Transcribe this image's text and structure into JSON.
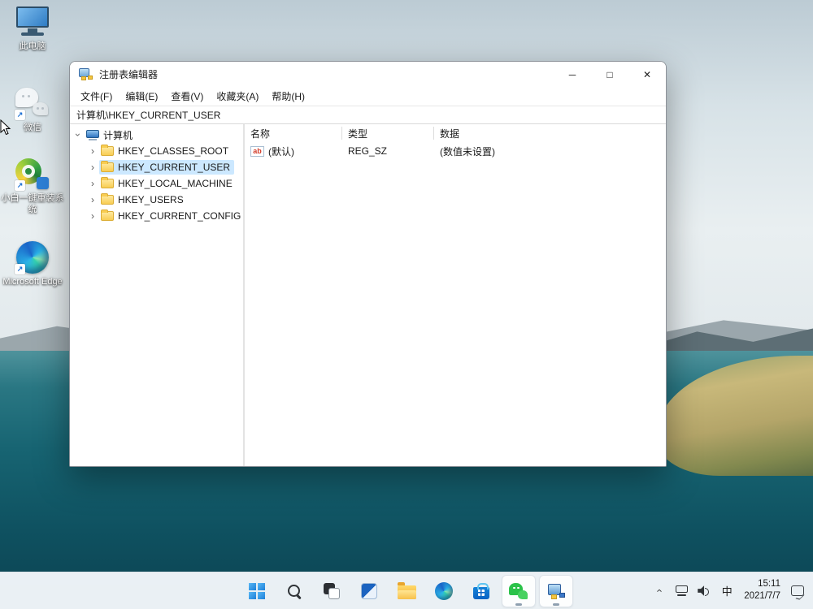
{
  "colors": {
    "selection": "#cce8ff",
    "accent": "#0078d4",
    "folder_yellow": "#f8cd52",
    "wechat_green": "#2bc24a",
    "taskbar_bg": "#f2f6fa",
    "water_teal": "#0f5261"
  },
  "desktop": {
    "icons": [
      {
        "label": "此电脑"
      },
      {
        "label": "微信"
      },
      {
        "label": "小白一键重装系统"
      },
      {
        "label": "Microsoft Edge"
      }
    ]
  },
  "registry_window": {
    "title": "注册表编辑器",
    "controls": {
      "minimize": "─",
      "maximize": "□",
      "close": "✕"
    },
    "menu": [
      {
        "label": "文件(F)"
      },
      {
        "label": "编辑(E)"
      },
      {
        "label": "查看(V)"
      },
      {
        "label": "收藏夹(A)"
      },
      {
        "label": "帮助(H)"
      }
    ],
    "address": "计算机\\HKEY_CURRENT_USER",
    "tree": {
      "root": {
        "label": "计算机"
      },
      "items": [
        {
          "label": "HKEY_CLASSES_ROOT",
          "selected": false
        },
        {
          "label": "HKEY_CURRENT_USER",
          "selected": true
        },
        {
          "label": "HKEY_LOCAL_MACHINE",
          "selected": false
        },
        {
          "label": "HKEY_USERS",
          "selected": false
        },
        {
          "label": "HKEY_CURRENT_CONFIG",
          "selected": false
        }
      ]
    },
    "list": {
      "columns": [
        {
          "label": "名称"
        },
        {
          "label": "类型"
        },
        {
          "label": "数据"
        }
      ],
      "rows": [
        {
          "icon": "reg-sz-icon",
          "icon_text": "ab",
          "name": "(默认)",
          "type": "REG_SZ",
          "data": "(数值未设置)"
        }
      ]
    }
  },
  "taskbar": {
    "icons": [
      "start",
      "search",
      "task-view",
      "widgets",
      "file-explorer",
      "edge",
      "store",
      "wechat",
      "registry-editor"
    ],
    "running_apps": [
      "wechat",
      "registry-editor"
    ],
    "tray": {
      "input_method": "中",
      "time": "15:11",
      "date": "2021/7/7"
    }
  }
}
